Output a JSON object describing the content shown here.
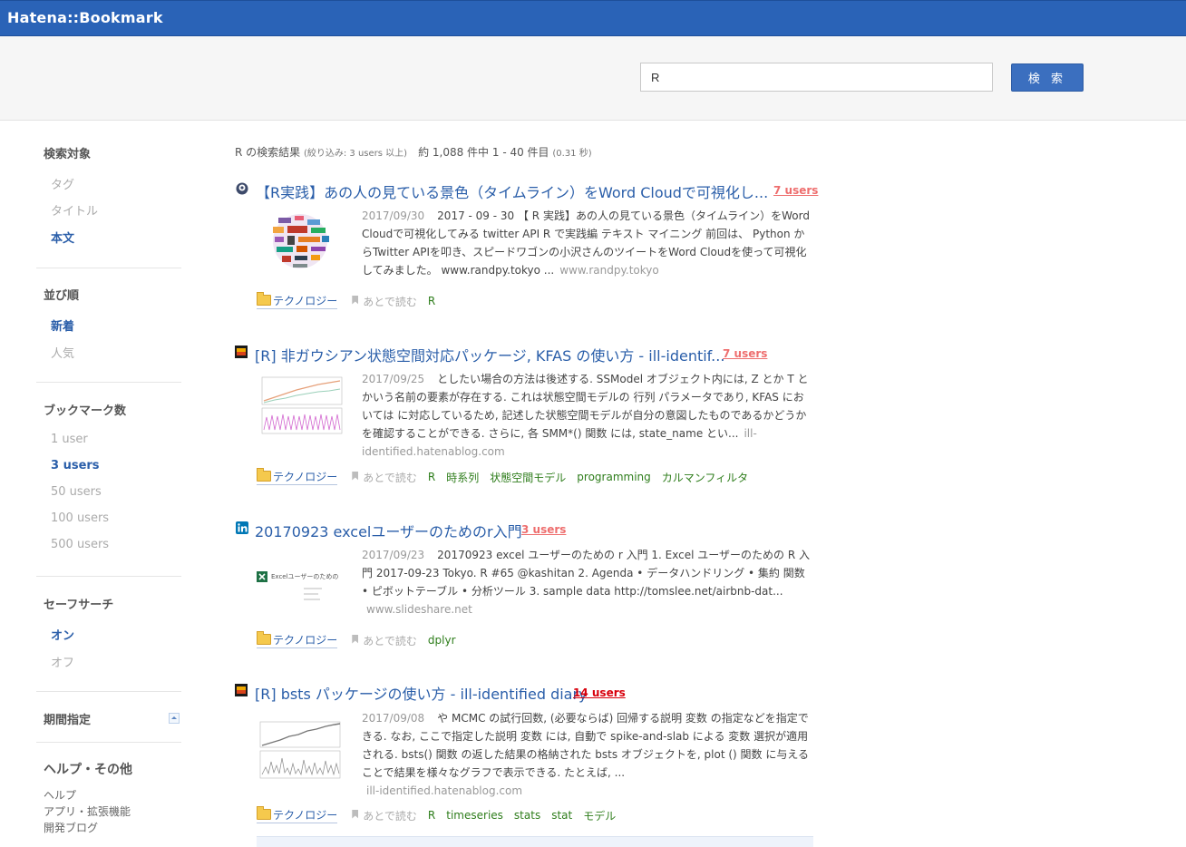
{
  "header": {
    "logo": "Hatena::Bookmark"
  },
  "search": {
    "value": "R",
    "button_label": "検 索"
  },
  "sidebar": {
    "target": {
      "heading": "検索対象",
      "items": [
        {
          "label": "タグ"
        },
        {
          "label": "タイトル"
        },
        {
          "label": "本文"
        }
      ],
      "active": "本文"
    },
    "sort": {
      "heading": "並び順",
      "items": [
        {
          "label": "新着"
        },
        {
          "label": "人気"
        }
      ],
      "active": "新着"
    },
    "count": {
      "heading": "ブックマーク数",
      "items": [
        {
          "label": "1 user"
        },
        {
          "label": "3 users"
        },
        {
          "label": "50 users"
        },
        {
          "label": "100 users"
        },
        {
          "label": "500 users"
        }
      ],
      "active": "3 users"
    },
    "safe": {
      "heading": "セーフサーチ",
      "items": [
        {
          "label": "オン"
        },
        {
          "label": "オフ"
        }
      ],
      "active": "オン"
    },
    "period": {
      "heading": "期間指定"
    },
    "help": {
      "heading": "ヘルプ・その他",
      "links": [
        {
          "label": "ヘルプ"
        },
        {
          "label": "アプリ・拡張機能"
        },
        {
          "label": "開発ブログ"
        }
      ]
    }
  },
  "summary": {
    "query": "R",
    "label": " の検索結果 ",
    "filter": "(絞り込み: 3 users 以上)",
    "count": "　約 1,088 件中 1 - 40 件目 ",
    "time": "(0.31 秒)"
  },
  "results": [
    {
      "title": "【R実践】あの人の見ている景色（タイムライン）をWord Cloudで可視化し...",
      "users": "7 users",
      "date": "2017/09/30",
      "snippet": "2017 - 09 - 30 【 R 実践】あの人の見ている景色（タイムライン）をWord Cloudで可視化してみる twitter API R で実践編 テキスト マイニング 前回は、 Python からTwitter APIを叩き、スピードワゴンの小沢さんのツイートをWord Cloudを使って可視化してみました。 www.randpy.tokyo ...",
      "domain": "www.randpy.tokyo",
      "category": "テクノロジー",
      "read_later": "あとで読む",
      "tags": [
        "R"
      ]
    },
    {
      "title": "[R] 非ガウシアン状態空間対応パッケージ, KFAS の使い方 - ill-identif...",
      "users": "7 users",
      "date": "2017/09/25",
      "snippet": "としたい場合の方法は後述する. SSModel オブジェクト内には, Z とか T とかいう名前の要素が存在する. これは状態空間モデルの 行列 パラメータであり, KFAS においては に対応しているため, 記述した状態空間モデルが自分の意図したものであるかどうかを確認することができる. さらに, 各 SMM*() 関数 には, state_name とい...",
      "domain": "ill-identified.hatenablog.com",
      "category": "テクノロジー",
      "read_later": "あとで読む",
      "tags": [
        "R",
        "時系列",
        "状態空間モデル",
        "programming",
        "カルマンフィルタ"
      ]
    },
    {
      "title": "20170923 excelユーザーのためのr入門",
      "users": "3 users",
      "date": "2017/09/23",
      "snippet": "20170923 excel ユーザーのための r 入門 1. Excel ユーザーのための R 入門 2017-09-23 Tokyo. R #65 @kashitan 2. Agenda • データハンドリング • 集約 関数 • ピボットテーブル • 分析ツール 3. sample data http://tomslee.net/airbnb-dat...",
      "domain": "www.slideshare.net",
      "category": "テクノロジー",
      "read_later": "あとで読む",
      "tags": [
        "dplyr"
      ],
      "thumb_text": "Excelユーザーのための"
    },
    {
      "title": "[R] bsts パッケージの使い方 - ill-identified diary",
      "users": "14 users",
      "date": "2017/09/08",
      "snippet": "や MCMC の試行回数, (必要ならば) 回帰する説明 変数 の指定などを指定できる. なお, ここで指定した説明 変数 には, 自動で spike-and-slab による 変数 選択が適用される. bsts() 関数 の返した結果の格納された bsts オブジェクトを, plot () 関数 に与えることで結果を様々なグラフで表示できる. たとえば, ...",
      "domain": "ill-identified.hatenablog.com",
      "category": "テクノロジー",
      "read_later": "あとで読む",
      "tags": [
        "R",
        "timeseries",
        "stats",
        "stat",
        "モデル"
      ]
    }
  ]
}
